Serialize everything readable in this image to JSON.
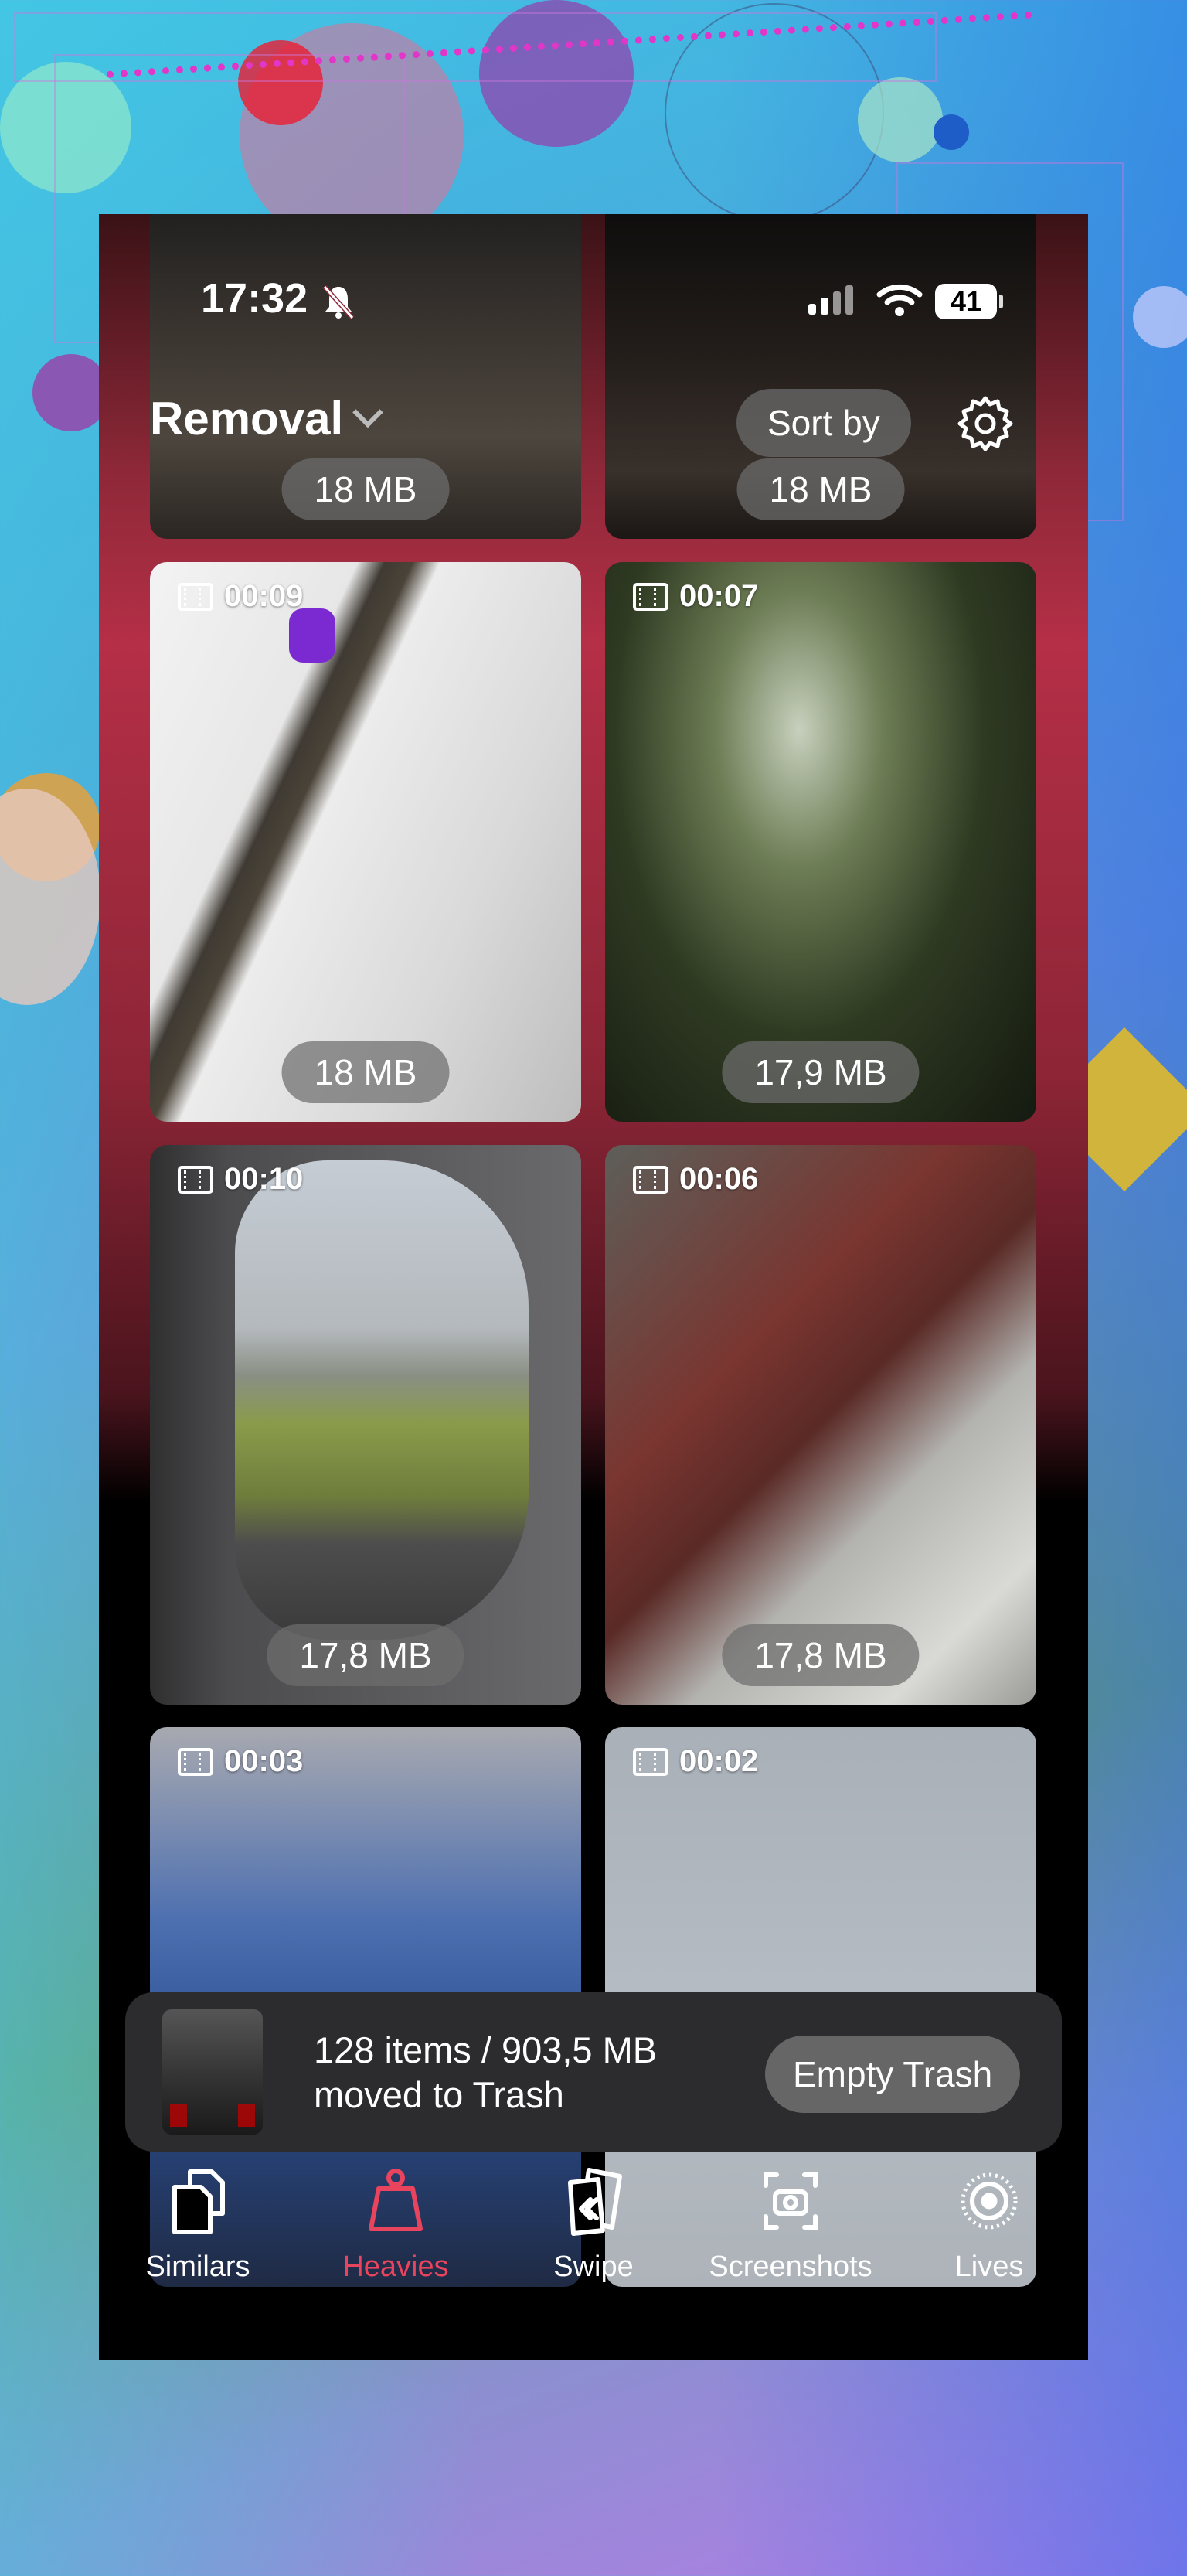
{
  "status_bar": {
    "time": "17:32",
    "battery": "41"
  },
  "header": {
    "title": "Removal",
    "sort_label": "Sort by"
  },
  "grid": {
    "tiles": [
      {
        "duration": "",
        "size": "18 MB"
      },
      {
        "duration": "",
        "size": "18 MB"
      },
      {
        "duration": "00:09",
        "size": "18 MB"
      },
      {
        "duration": "00:07",
        "size": "17,9 MB"
      },
      {
        "duration": "00:10",
        "size": "17,8 MB"
      },
      {
        "duration": "00:06",
        "size": "17,8 MB"
      },
      {
        "duration": "00:03",
        "size": ""
      },
      {
        "duration": "00:02",
        "size": ""
      }
    ]
  },
  "toast": {
    "line1": "128 items / 903,5 MB",
    "line2": "moved to Trash",
    "button": "Empty Trash"
  },
  "tabs": [
    {
      "label": "Similars",
      "icon": "documents-icon",
      "active": false
    },
    {
      "label": "Heavies",
      "icon": "weight-icon",
      "active": true
    },
    {
      "label": "Swipe",
      "icon": "swipe-cards-icon",
      "active": false
    },
    {
      "label": "Screenshots",
      "icon": "screenshot-camera-icon",
      "active": false
    },
    {
      "label": "Lives",
      "icon": "live-photo-icon",
      "active": false
    }
  ],
  "colors": {
    "accent": "#e8445e",
    "toast_bg": "#2c2c2e",
    "pill_bg": "#6e6e6e"
  }
}
